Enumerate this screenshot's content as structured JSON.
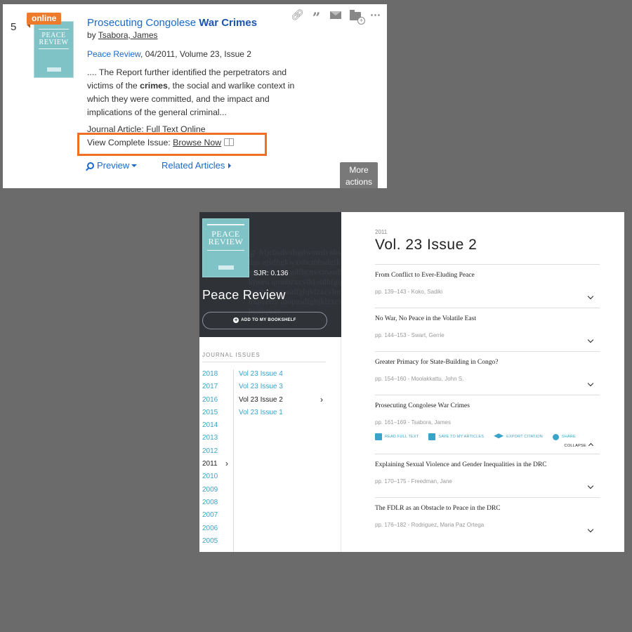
{
  "result": {
    "number": "5",
    "badge": "online",
    "cover_title": "PEACE REVIEW",
    "title_prefix": "Prosecuting Congolese ",
    "title_bold": "War Crimes",
    "by_label": "by ",
    "author": "Tsabora, James",
    "journal": "Peace Review",
    "pub_details": ", 04/2011, Volume 23, Issue 2",
    "snippet_pre": ".... The Report further identified the perpetrators and victims of the ",
    "snippet_bold": "crimes",
    "snippet_post": ", the social and warlike context in which they were committed, and the impact and implications of the general criminal...",
    "type": "Journal Article: Full Text Online",
    "view_label": "View Complete Issue: ",
    "browse_now": "Browse Now",
    "preview": "Preview",
    "related": "Related Articles",
    "more_actions_line1": "More",
    "more_actions_line2": "actions",
    "toolbar_icons": [
      "link-icon",
      "quote-icon",
      "email-icon",
      "add-folder-icon",
      "more-icon"
    ],
    "highlight_color": "#ef7023"
  },
  "browse": {
    "cover_title": "PEACE REVIEW",
    "sjr": "SJR: 0.136",
    "journal_title": "Peace Review",
    "bookshelf": "ADD TO MY BOOKSHELF",
    "journal_issues_label": "JOURNAL ISSUES",
    "years": [
      "2018",
      "2017",
      "2016",
      "2015",
      "2014",
      "2013",
      "2012",
      "2011",
      "2010",
      "2009",
      "2008",
      "2007",
      "2006",
      "2005"
    ],
    "selected_year": "2011",
    "issues": [
      "Vol 23 Issue 4",
      "Vol 23 Issue 3",
      "Vol 23 Issue 2",
      "Vol 23 Issue 1"
    ],
    "selected_issue": "Vol 23 Issue 2",
    "year_label": "2011",
    "volume_title": "Vol. 23 Issue 2",
    "articles": [
      {
        "title": "From Conflict to Ever-Eluding Peace",
        "pages": "pp. 139–143",
        "authors": "Koko, Sadiki"
      },
      {
        "title": "No War, No Peace in the Volatile East",
        "pages": "pp. 144–153",
        "authors": "Swart, Gerrie"
      },
      {
        "title": "Greater Primacy for State-Building in Congo?",
        "pages": "pp. 154–160",
        "authors": "Moolakkattu, John S."
      },
      {
        "title": "Prosecuting Congolese War Crimes",
        "pages": "pp. 161–169",
        "authors": "Tsabora, James"
      },
      {
        "title": "Explaining Sexual Violence and Gender Inequalities in the DRC",
        "pages": "pp. 170–175",
        "authors": "Freedman, Jane"
      },
      {
        "title": "The FDLR as an Obstacle to Peace in the DRC",
        "pages": "pp. 176–182",
        "authors": "Rodriguez, Maria Paz Ortega"
      }
    ],
    "expanded_actions": [
      "READ FULL TEXT",
      "SAVE TO MY ARTICLES",
      "EXPORT CITATION",
      "SHARE"
    ],
    "collapse": "COLLAPSE",
    "accent_color": "#3aa3c9"
  }
}
